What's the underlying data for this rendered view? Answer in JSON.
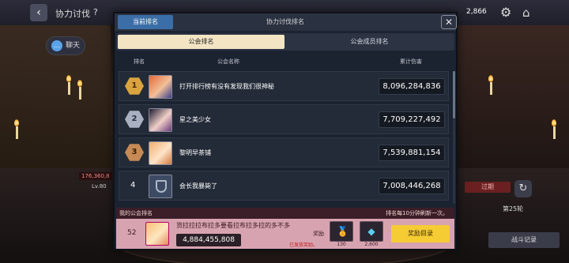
{
  "topbar": {
    "title": "协力讨伐",
    "help": "?",
    "currency": "2,866"
  },
  "side": {
    "chat_label": "聊天",
    "chat_icon": "chat-icon",
    "hp_text": "176,360,8",
    "level_text": "Lv.80",
    "expired_label": "过期",
    "round_label": "第25轮",
    "battle_log_label": "战斗记录"
  },
  "modal": {
    "head_tab": "当前排名",
    "title": "协力讨伐排名",
    "close": "✕",
    "tabs": [
      {
        "label": "公会排名",
        "active": true
      },
      {
        "label": "公会成员排名",
        "active": false
      }
    ],
    "columns": {
      "rank": "排名",
      "name": "公会名称",
      "damage": "累计伤害"
    },
    "rows": [
      {
        "rank": "1",
        "name": "打开排行榜有没有发现我们很神秘",
        "damage": "8,096,284,836"
      },
      {
        "rank": "2",
        "name": "星之美少女",
        "damage": "7,709,227,492"
      },
      {
        "rank": "3",
        "name": "黎明早茶铺",
        "damage": "7,539,881,154"
      },
      {
        "rank": "4",
        "name": "会长我暴毙了",
        "damage": "7,008,446,268"
      }
    ],
    "my_guild": {
      "label": "我的公会排名",
      "refresh_note": "排名每10分钟刷新一次。",
      "rank": "52",
      "name": "货拉拉拉布拉多要看拉布拉多拉的多不多",
      "damage": "4,884,455,808",
      "reward_label": "奖励",
      "claimed_label": "已发放奖励。",
      "items": [
        {
          "icon": "medal-icon",
          "count": "130"
        },
        {
          "icon": "diamond-icon",
          "count": "2,600"
        }
      ],
      "reward_button": "奖励目录"
    }
  }
}
